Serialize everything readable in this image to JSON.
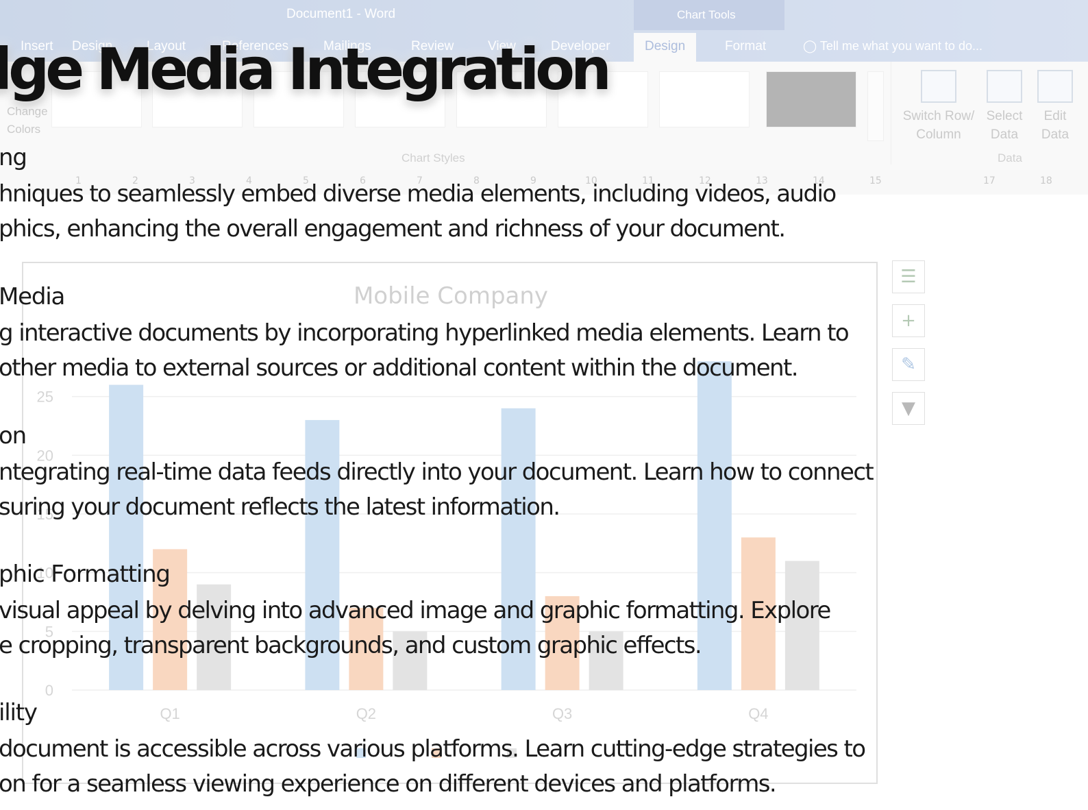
{
  "word": {
    "window_title": "Document1 - Word",
    "contextual_title": "Chart Tools",
    "tabs": [
      "Insert",
      "Design",
      "Layout",
      "References",
      "Mailings",
      "Review",
      "View",
      "Developer",
      "Design",
      "Format"
    ],
    "active_tab": "Design",
    "tell_me": "Tell me what you want to do...",
    "ribbon": {
      "change_colors_line1": "Change",
      "change_colors_line2": "Colors",
      "chart_styles_label": "Chart Styles",
      "switch_row_line1": "Switch Row/",
      "switch_row_line2": "Column",
      "select_data_line1": "Select",
      "select_data_line2": "Data",
      "edit_data_line1": "Edit",
      "edit_data_line2": "Data",
      "data_group_label": "Data"
    },
    "ruler_numbers": [
      "1",
      "2",
      "3",
      "4",
      "5",
      "6",
      "7",
      "8",
      "9",
      "10",
      "11",
      "12",
      "13",
      "14",
      "15",
      "17",
      "18"
    ],
    "colors": {
      "titlebar": "#8ea7cf",
      "accent": "#4b6fb5"
    }
  },
  "chart_data": {
    "type": "bar",
    "title": "Mobile Company",
    "categories": [
      "Q1",
      "Q2",
      "Q3",
      "Q4"
    ],
    "series": [
      {
        "values": [
          26,
          23,
          24,
          28
        ],
        "color": "#5b9bd5"
      },
      {
        "values": [
          12,
          7,
          8,
          13
        ],
        "color": "#ed7d31"
      },
      {
        "values": [
          9,
          5,
          5,
          11
        ],
        "color": "#a5a5a5"
      }
    ],
    "y_ticks": [
      "0",
      "5",
      "10",
      "15",
      "20",
      "25"
    ],
    "ylim": [
      0,
      30
    ],
    "legend_position": "bottom",
    "grid": true
  },
  "slide": {
    "headline": "dge Media Integration",
    "sections": [
      {
        "title": "ng",
        "lines": [
          "hniques to seamlessly embed diverse media elements, including videos, audio",
          "phics, enhancing the overall engagement and richness of your document."
        ]
      },
      {
        "title": "Media",
        "lines": [
          "g interactive documents by incorporating hyperlinked media elements. Learn to",
          "other media to external sources or additional content within the document."
        ]
      },
      {
        "title": "on",
        "lines": [
          "ntegrating real-time data feeds directly into your document. Learn how to connect",
          "suring your document reflects the latest information."
        ]
      },
      {
        "title": "phic Formatting",
        "lines": [
          "visual appeal by delving into advanced image and graphic formatting. Explore",
          "e cropping, transparent backgrounds, and custom graphic effects."
        ]
      },
      {
        "title": "ility",
        "lines": [
          "document is accessible across various platforms. Learn cutting-edge strategies to",
          "on for a seamless viewing experience on different devices and platforms."
        ]
      }
    ]
  }
}
